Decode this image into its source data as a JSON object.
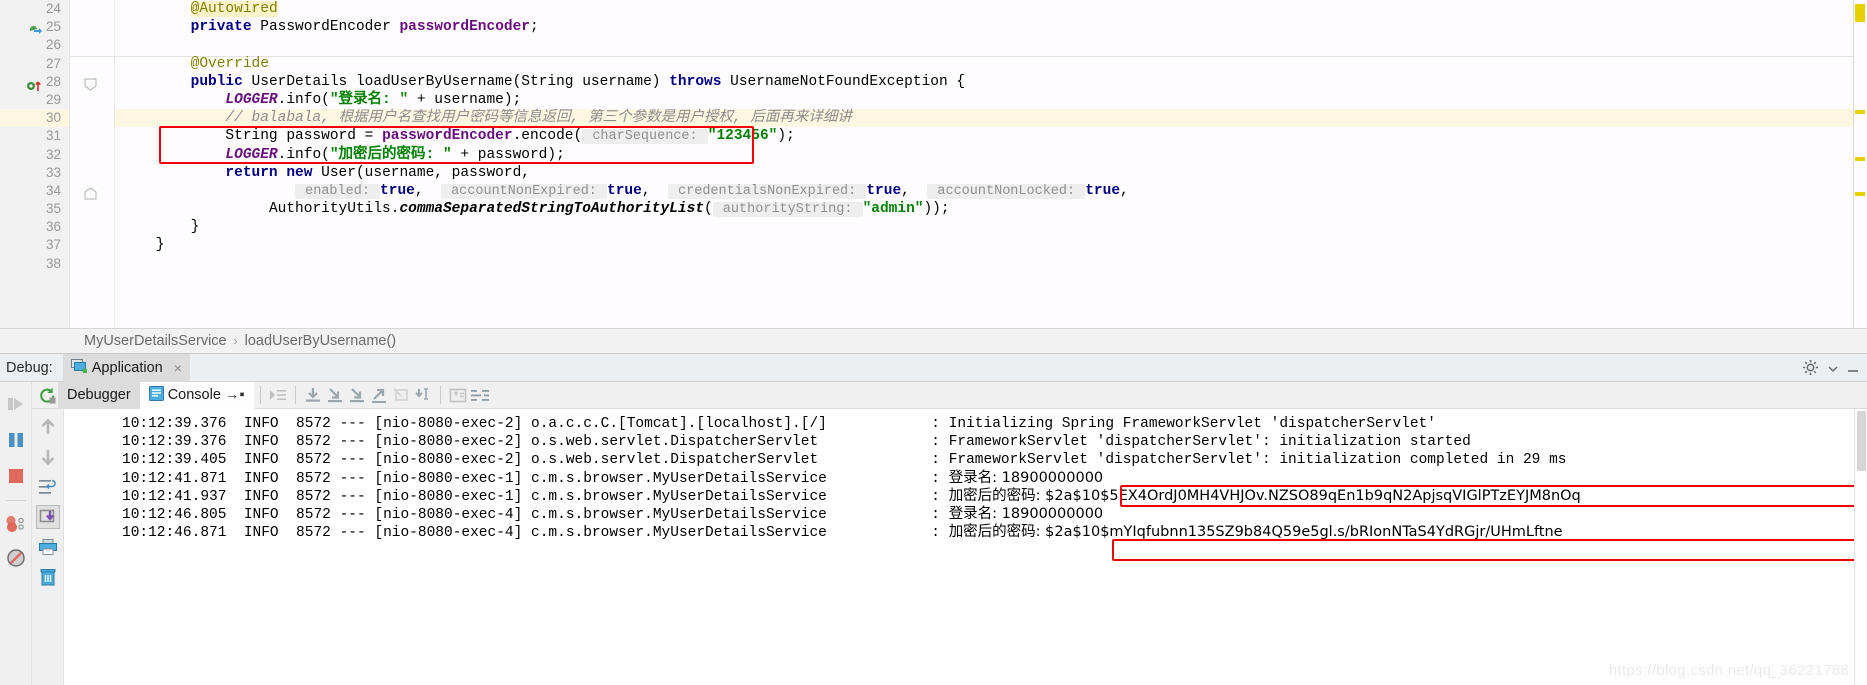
{
  "editor": {
    "line_numbers": [
      "24",
      "25",
      "26",
      "27",
      "28",
      "29",
      "30",
      "31",
      "32",
      "33",
      "34",
      "35",
      "36",
      "37",
      "38"
    ],
    "code_lines": [
      {
        "n": "24",
        "segments": [
          {
            "t": "        ",
            "c": "plain"
          },
          {
            "t": "@Autowired",
            "c": "annhl"
          }
        ]
      },
      {
        "n": "25",
        "segments": [
          {
            "t": "        ",
            "c": "plain"
          },
          {
            "t": "private",
            "c": "kw"
          },
          {
            "t": " PasswordEncoder ",
            "c": "plain"
          },
          {
            "t": "passwordEncoder",
            "c": "fldb"
          },
          {
            "t": ";",
            "c": "plain"
          }
        ]
      },
      {
        "n": "26",
        "segments": []
      },
      {
        "n": "27",
        "segments": [
          {
            "t": "        ",
            "c": "plain"
          },
          {
            "t": "@Override",
            "c": "ann"
          }
        ]
      },
      {
        "n": "28",
        "segments": [
          {
            "t": "        ",
            "c": "plain"
          },
          {
            "t": "public",
            "c": "kw"
          },
          {
            "t": " UserDetails loadUserByUsername(String username) ",
            "c": "plain"
          },
          {
            "t": "throws",
            "c": "kw"
          },
          {
            "t": " UsernameNotFoundException {",
            "c": "plain"
          }
        ]
      },
      {
        "n": "29",
        "segments": [
          {
            "t": "            ",
            "c": "plain"
          },
          {
            "t": "LOGGER",
            "c": "fld"
          },
          {
            "t": ".info(",
            "c": "plain"
          },
          {
            "t": "\"登录名: \"",
            "c": "str"
          },
          {
            "t": " + username);",
            "c": "plain"
          }
        ]
      },
      {
        "n": "30",
        "segments": [
          {
            "t": "            ",
            "c": "plain"
          },
          {
            "t": "// balabala, 根据用户名查找用户密码等信息返回, 第三个参数是用户授权, 后面再来详细讲",
            "c": "cmt"
          }
        ]
      },
      {
        "n": "31",
        "segments": [
          {
            "t": "            ",
            "c": "plain"
          },
          {
            "t": "String password = ",
            "c": "plain"
          },
          {
            "t": "passwordEncoder",
            "c": "fldb"
          },
          {
            "t": ".encode(",
            "c": "plain"
          },
          {
            "t": " charSequence: ",
            "c": "hint"
          },
          {
            "t": "\"123456\"",
            "c": "str"
          },
          {
            "t": ");",
            "c": "plain"
          }
        ]
      },
      {
        "n": "32",
        "segments": [
          {
            "t": "            ",
            "c": "plain"
          },
          {
            "t": "LOGGER",
            "c": "fld"
          },
          {
            "t": ".info(",
            "c": "plain"
          },
          {
            "t": "\"加密后的密码: \"",
            "c": "str"
          },
          {
            "t": " + password);",
            "c": "plain"
          }
        ]
      },
      {
        "n": "33",
        "segments": [
          {
            "t": "            ",
            "c": "plain"
          },
          {
            "t": "return",
            "c": "kw"
          },
          {
            "t": " ",
            "c": "plain"
          },
          {
            "t": "new",
            "c": "kw"
          },
          {
            "t": " User(username, password,",
            "c": "plain"
          }
        ]
      },
      {
        "n": "34",
        "segments": [
          {
            "t": "                    ",
            "c": "plain"
          },
          {
            "t": " enabled: ",
            "c": "hint"
          },
          {
            "t": "true",
            "c": "kw"
          },
          {
            "t": ",  ",
            "c": "plain"
          },
          {
            "t": " accountNonExpired: ",
            "c": "hint"
          },
          {
            "t": "true",
            "c": "kw"
          },
          {
            "t": ",  ",
            "c": "plain"
          },
          {
            "t": " credentialsNonExpired: ",
            "c": "hint"
          },
          {
            "t": "true",
            "c": "kw"
          },
          {
            "t": ",  ",
            "c": "plain"
          },
          {
            "t": " accountNonLocked: ",
            "c": "hint"
          },
          {
            "t": "true",
            "c": "kw"
          },
          {
            "t": ",",
            "c": "plain"
          }
        ]
      },
      {
        "n": "35",
        "segments": [
          {
            "t": "                 ",
            "c": "plain"
          },
          {
            "t": "AuthorityUtils.",
            "c": "plain"
          },
          {
            "t": "commaSeparatedStringToAuthorityList",
            "c": "cmt2"
          },
          {
            "t": "(",
            "c": "plain"
          },
          {
            "t": " authorityString: ",
            "c": "hint"
          },
          {
            "t": "\"admin\"",
            "c": "str"
          },
          {
            "t": "));",
            "c": "plain"
          }
        ]
      },
      {
        "n": "36",
        "segments": [
          {
            "t": "        }",
            "c": "plain"
          }
        ]
      },
      {
        "n": "37",
        "segments": [
          {
            "t": "    }",
            "c": "plain"
          }
        ]
      },
      {
        "n": "38",
        "segments": []
      }
    ],
    "highlight_line_index": 6,
    "gutter_icons": [
      {
        "line": 1,
        "name": "bean-arrow-icon"
      },
      {
        "line": 4,
        "name": "override-method-icon"
      }
    ],
    "fold_marker_line": 4,
    "scrollbar_marks": [
      "warning-mark-top",
      "warning-mark-line30",
      "warning-mark-line32",
      "warning-mark-line35"
    ]
  },
  "breadcrumb": {
    "class_name": "MyUserDetailsService",
    "separator": "›",
    "method_name": "loadUserByUsername()"
  },
  "debug": {
    "panel_label": "Debug:",
    "run_config_name": "Application",
    "close_tab_label": "×",
    "settings_icon": "gear-icon",
    "minimize_icon": "minimize-icon",
    "tabs": [
      {
        "label": "Debugger",
        "active": false,
        "icon": "debugger-icon"
      },
      {
        "label": "Console",
        "active": true,
        "icon": "console-icon"
      }
    ],
    "console_soft_wrap_glyph": "→▪",
    "toolbar_icons": [
      "run-to-cursor-icon",
      "step-over-icon",
      "step-into-icon",
      "force-step-into-icon",
      "step-out-icon",
      "drop-frame-icon",
      "run-to-cursor-2-icon",
      "evaluate-expression-icon",
      "view-breakpoints-icon"
    ],
    "left_rail_icons": [
      "resume-program-icon",
      "pause-program-icon",
      "stop-program-icon",
      "view-breakpoints-icon",
      "mute-breakpoints-icon"
    ],
    "console_rail_icons": [
      "scroll-up-icon",
      "scroll-down-icon",
      "soft-wrap-icon",
      "scroll-to-end-icon",
      "print-icon",
      "clear-all-icon"
    ]
  },
  "console": {
    "lines": [
      {
        "time": "10:12:39.376",
        "level": "INFO",
        "pid": "8572",
        "dashes": "---",
        "thread": "[nio-8080-exec-2]",
        "logger": "o.a.c.c.C.[Tomcat].[localhost].[/]",
        "colon": ":",
        "message": "Initializing Spring FrameworkServlet 'dispatcherServlet'",
        "boxed": false,
        "cjk": false
      },
      {
        "time": "10:12:39.376",
        "level": "INFO",
        "pid": "8572",
        "dashes": "---",
        "thread": "[nio-8080-exec-2]",
        "logger": "o.s.web.servlet.DispatcherServlet",
        "colon": ":",
        "message": "FrameworkServlet 'dispatcherServlet': initialization started",
        "boxed": false,
        "cjk": false
      },
      {
        "time": "10:12:39.405",
        "level": "INFO",
        "pid": "8572",
        "dashes": "---",
        "thread": "[nio-8080-exec-2]",
        "logger": "o.s.web.servlet.DispatcherServlet",
        "colon": ":",
        "message": "FrameworkServlet 'dispatcherServlet': initialization completed in 29 ms",
        "boxed": false,
        "cjk": false
      },
      {
        "time": "10:12:41.871",
        "level": "INFO",
        "pid": "8572",
        "dashes": "---",
        "thread": "[nio-8080-exec-1]",
        "logger": "c.m.s.browser.MyUserDetailsService",
        "colon": ":",
        "message": "登录名: 18900000000",
        "boxed": false,
        "cjk": true
      },
      {
        "time": "10:12:41.937",
        "level": "INFO",
        "pid": "8572",
        "dashes": "---",
        "thread": "[nio-8080-exec-1]",
        "logger": "c.m.s.browser.MyUserDetailsService",
        "colon": ":",
        "message": "加密后的密码: $2a$10$5EX4OrdJ0MH4VHJOv.NZSO89qEn1b9qN2ApjsqVIGlPTzEYJM8nOq",
        "boxed": true,
        "cjk": true
      },
      {
        "time": "10:12:46.805",
        "level": "INFO",
        "pid": "8572",
        "dashes": "---",
        "thread": "[nio-8080-exec-4]",
        "logger": "c.m.s.browser.MyUserDetailsService",
        "colon": ":",
        "message": "登录名: 18900000000",
        "boxed": false,
        "cjk": true
      },
      {
        "time": "10:12:46.871",
        "level": "INFO",
        "pid": "8572",
        "dashes": "---",
        "thread": "[nio-8080-exec-4]",
        "logger": "c.m.s.browser.MyUserDetailsService",
        "colon": ":",
        "message": "加密后的密码: $2a$10$mYIqfubnn135SZ9b84Q59e5gl.s/bRIonNTaS4YdRGjr/UHmLftne",
        "boxed": true,
        "cjk": true
      }
    ]
  },
  "watermark": "https://blog.csdn.net/qq_36221788",
  "colors": {
    "annotation_box": "#f20000",
    "keyword": "#000080",
    "string": "#008000",
    "comment": "#8c8c8c",
    "field": "#660e7a",
    "highlight_row": "#fdf7e2",
    "editor_bg": "#fffcff",
    "panel_bg": "#f0f0f0"
  }
}
